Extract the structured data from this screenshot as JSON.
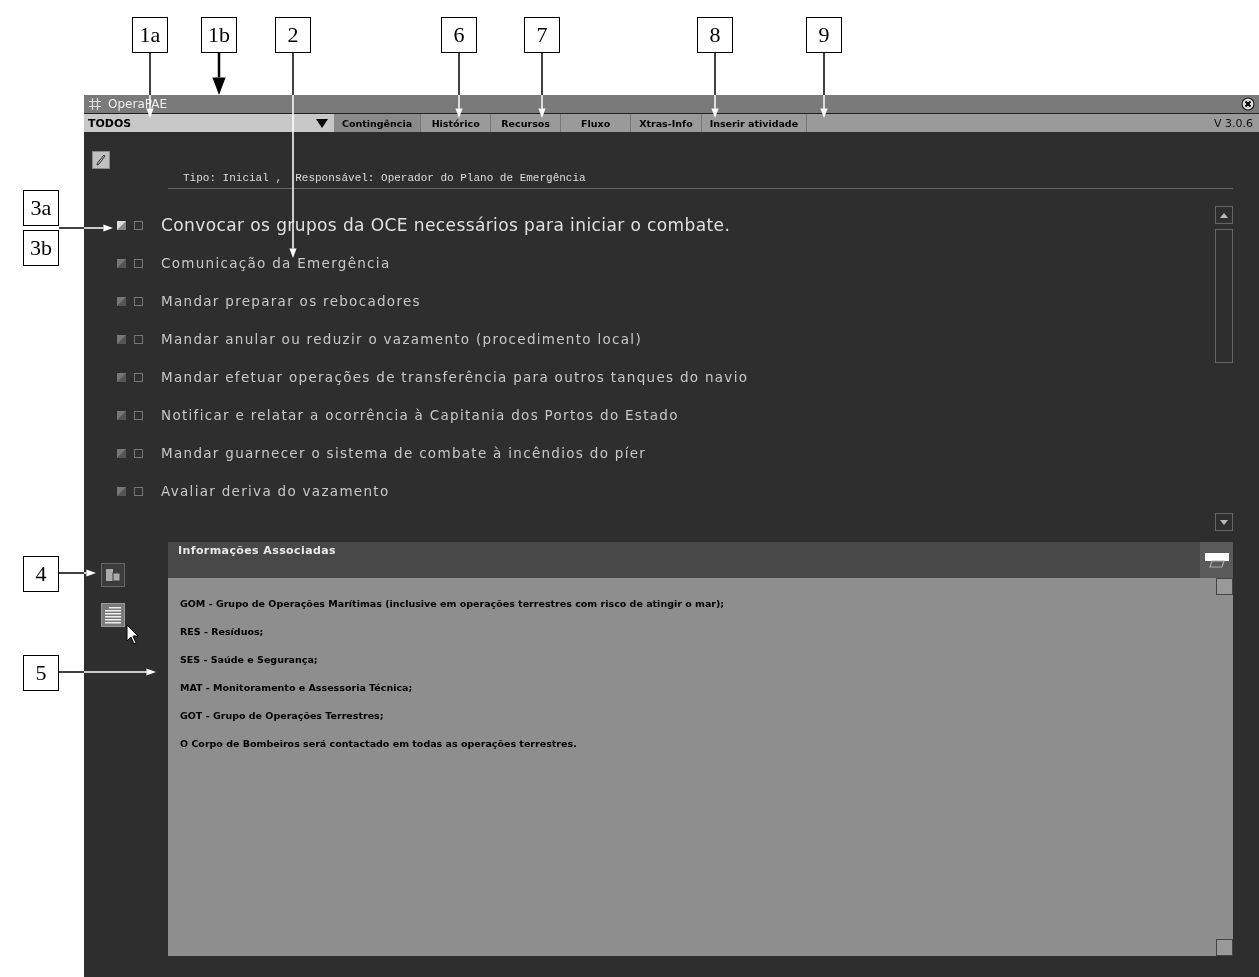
{
  "window": {
    "title": "OperaPAE"
  },
  "toolbar": {
    "filter": "TODOS",
    "tabs": [
      {
        "label": "Contingência",
        "selected": true
      },
      {
        "label": "Histórico",
        "selected": false
      },
      {
        "label": "Recursos",
        "selected": false
      },
      {
        "label": "Fluxo",
        "selected": false
      },
      {
        "label": "Xtras-Info",
        "selected": false
      },
      {
        "label": "Inserir atividade",
        "selected": false
      }
    ],
    "version": "V 3.0.6"
  },
  "header": "Tipo: Inicial ,  Responsável: Operador do Plano de Emergência",
  "activities": [
    {
      "text": "Convocar os grupos da OCE necessários para iniciar o combate.",
      "selected": true,
      "checked": false
    },
    {
      "text": "Comunicação da Emergência",
      "selected": false,
      "checked": false
    },
    {
      "text": "Mandar preparar os rebocadores",
      "selected": false,
      "checked": false
    },
    {
      "text": "Mandar anular ou reduzir o vazamento (procedimento local)",
      "selected": false,
      "checked": false
    },
    {
      "text": "Mandar efetuar operações de transferência para outros tanques do navio",
      "selected": false,
      "checked": false
    },
    {
      "text": "Notificar e relatar a ocorrência à Capitania dos Portos do Estado",
      "selected": false,
      "checked": false
    },
    {
      "text": "Mandar guarnecer o sistema de combate à incêndios do píer",
      "selected": false,
      "checked": false
    },
    {
      "text": "Avaliar deriva do vazamento",
      "selected": false,
      "checked": false
    }
  ],
  "sidebar": [
    {
      "kind": "layout",
      "selected": false
    },
    {
      "kind": "list",
      "selected": true
    }
  ],
  "info": {
    "title": "Informações Associadas",
    "lines": [
      "GOM - Grupo de Operações Marítimas (inclusive em operações terrestres com risco de atingir o mar);",
      "RES - Resíduos;",
      "SES - Saúde e Segurança;",
      "MAT - Monitoramento e Assessoria Técnica;",
      "GOT - Grupo de Operações Terrestres;",
      "O Corpo de Bombeiros será contactado em todas as operações terrestres."
    ]
  },
  "callouts": [
    {
      "label": "1a"
    },
    {
      "label": "1b"
    },
    {
      "label": "2"
    },
    {
      "label": "6"
    },
    {
      "label": "7"
    },
    {
      "label": "8"
    },
    {
      "label": "9"
    },
    {
      "label": "3a"
    },
    {
      "label": "3b"
    },
    {
      "label": "4"
    },
    {
      "label": "5"
    }
  ]
}
